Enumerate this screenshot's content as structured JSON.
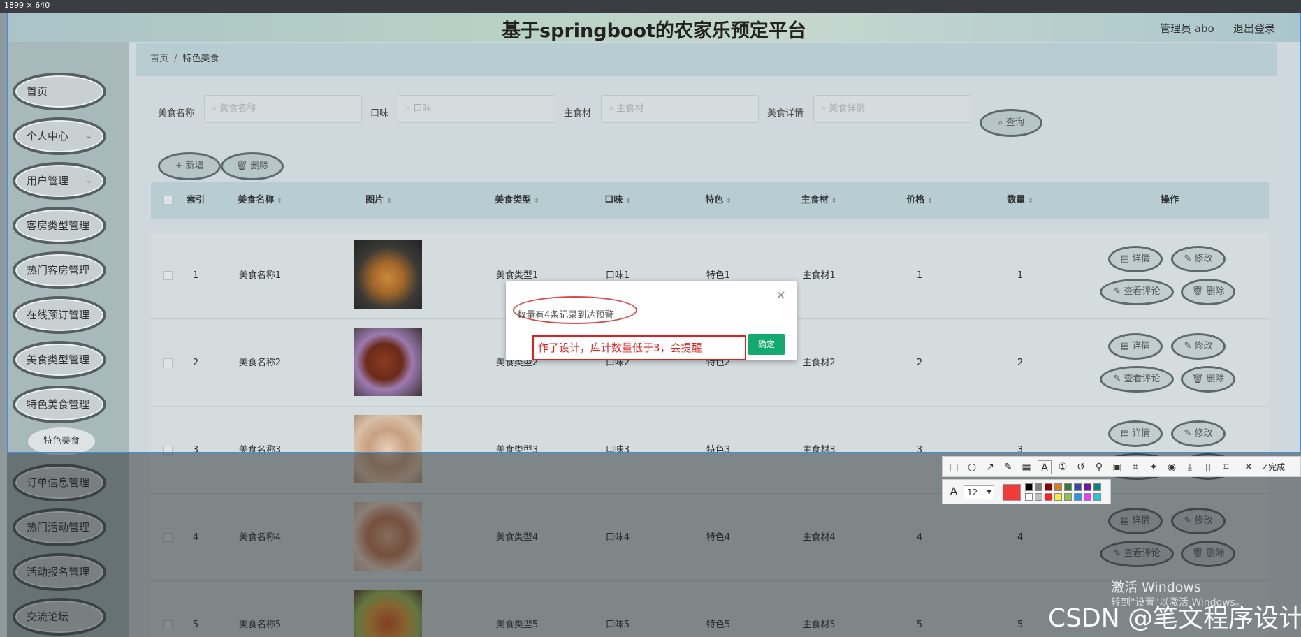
{
  "screen_size_label": "1899 × 640",
  "header": {
    "title": "基于springboot的农家乐预定平台",
    "admin": "管理员 abo",
    "logout": "退出登录"
  },
  "sidebar": {
    "items": [
      {
        "label": "首页"
      },
      {
        "label": "个人中心"
      },
      {
        "label": "用户管理"
      },
      {
        "label": "客房类型管理"
      },
      {
        "label": "热门客房管理"
      },
      {
        "label": "在线预订管理"
      },
      {
        "label": "美食类型管理"
      },
      {
        "label": "特色美食管理"
      },
      {
        "label": "订单信息管理"
      },
      {
        "label": "热门活动管理"
      },
      {
        "label": "活动报名管理"
      },
      {
        "label": "交流论坛"
      }
    ],
    "sub_item": "特色美食",
    "chevron": "⌄"
  },
  "breadcrumb": {
    "home": "首页",
    "sep": "/",
    "current": "特色美食"
  },
  "filters": [
    {
      "label": "美食名称",
      "placeholder": "美食名称"
    },
    {
      "label": "口味",
      "placeholder": "口味"
    },
    {
      "label": "主食材",
      "placeholder": "主食材"
    },
    {
      "label": "美食详情",
      "placeholder": "美食详情"
    }
  ],
  "buttons": {
    "search": "查询",
    "add": "新增",
    "delete": "删除"
  },
  "table": {
    "headers": [
      "索引",
      "美食名称",
      "图片",
      "美食类型",
      "口味",
      "特色",
      "主食材",
      "价格",
      "数量",
      "操作"
    ],
    "rows": [
      {
        "index": "1",
        "name": "美食名称1",
        "type": "美食类型1",
        "taste": "口味1",
        "feature": "特色1",
        "ingredient": "主食材1",
        "price": "1",
        "qty": "1"
      },
      {
        "index": "2",
        "name": "美食名称2",
        "type": "美食类型2",
        "taste": "口味2",
        "feature": "特色2",
        "ingredient": "主食材2",
        "price": "2",
        "qty": "2"
      },
      {
        "index": "3",
        "name": "美食名称3",
        "type": "美食类型3",
        "taste": "口味3",
        "feature": "特色3",
        "ingredient": "主食材3",
        "price": "3",
        "qty": "3"
      },
      {
        "index": "4",
        "name": "美食名称4",
        "type": "美食类型4",
        "taste": "口味4",
        "feature": "特色4",
        "ingredient": "主食材4",
        "price": "4",
        "qty": "4"
      },
      {
        "index": "5",
        "name": "美食名称5",
        "type": "美食类型5",
        "taste": "口味5",
        "feature": "特色5",
        "ingredient": "主食材5",
        "price": "5",
        "qty": "5"
      }
    ],
    "actions": {
      "detail": "详情",
      "edit": "修改",
      "comments": "查看评论",
      "delete": "删除"
    }
  },
  "dialog": {
    "message": "数量有4条记录到达预警",
    "close": "×",
    "ok": "确定"
  },
  "annotation": "作了设计，库计数量低于3，会提醒",
  "screenshot_toolbar": {
    "font_size": "12",
    "finish": "完成"
  },
  "watermark": {
    "line1": "激活 Windows",
    "line2": "转到\"设置\"以激活 Windows。"
  },
  "csdn": "CSDN @笔文程序设计"
}
